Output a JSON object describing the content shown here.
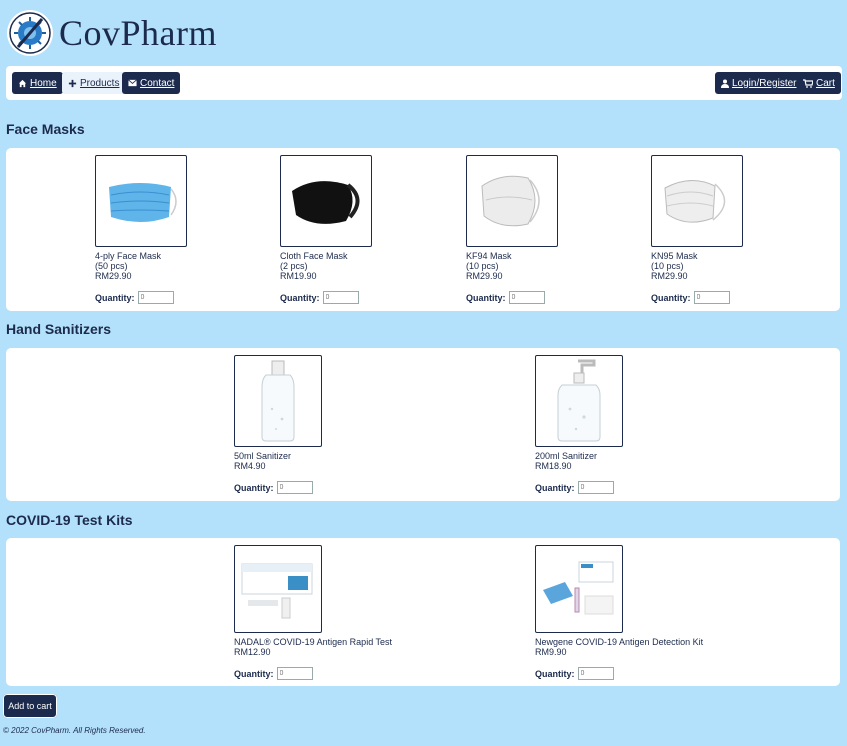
{
  "brand": {
    "name": "CovPharm"
  },
  "nav": {
    "home": "Home",
    "products": "Products",
    "contact": "Contact",
    "login": "Login/Register",
    "cart": "Cart"
  },
  "sections": [
    {
      "title": "Face Masks",
      "products": [
        {
          "name": "4-ply Face Mask",
          "pack": "(50 pcs)",
          "price": "RM29.90"
        },
        {
          "name": "Cloth Face Mask",
          "pack": "(2 pcs)",
          "price": "RM19.90"
        },
        {
          "name": "KF94 Mask",
          "pack": "(10 pcs)",
          "price": "RM29.90"
        },
        {
          "name": "KN95 Mask",
          "pack": "(10 pcs)",
          "price": "RM29.90"
        }
      ]
    },
    {
      "title": "Hand Sanitizers",
      "products": [
        {
          "name": "50ml Sanitizer",
          "price": "RM4.90"
        },
        {
          "name": "200ml Sanitizer",
          "price": "RM18.90"
        }
      ]
    },
    {
      "title": "COVID-19 Test Kits",
      "products": [
        {
          "name": "NADAL® COVID-19 Antigen Rapid Test",
          "price": "RM12.90"
        },
        {
          "name": "Newgene COVID-19 Antigen Detection Kit",
          "price": "RM9.90"
        }
      ]
    }
  ],
  "quantity_label": "Quantity:",
  "quantity_placeholder": "0",
  "add_to_cart": "Add to cart",
  "footer": "© 2022 CovPharm. All Rights Reserved.",
  "icons": {
    "home": "home-icon",
    "products": "plus-icon",
    "contact": "envelope-icon",
    "login": "user-icon",
    "cart": "cart-icon",
    "logo": "virus-logo-icon"
  },
  "colors": {
    "background": "#b3e0fa",
    "navy": "#1c2b4d",
    "panel": "#ffffff"
  }
}
